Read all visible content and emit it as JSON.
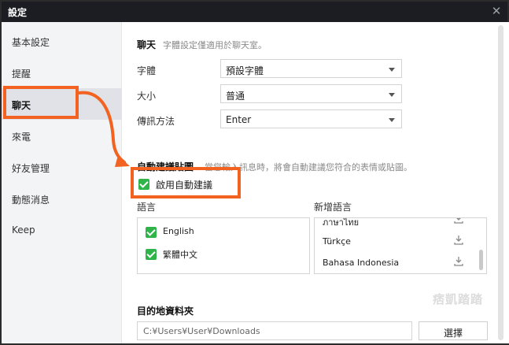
{
  "window": {
    "title": "設定",
    "close_icon": "close-icon"
  },
  "sidebar": {
    "items": [
      {
        "label": "基本設定"
      },
      {
        "label": "提醒"
      },
      {
        "label": "聊天",
        "active": true
      },
      {
        "label": "來電"
      },
      {
        "label": "好友管理"
      },
      {
        "label": "動態消息"
      },
      {
        "label": "Keep"
      }
    ]
  },
  "chat_section": {
    "title": "聊天",
    "description": "字體設定僅適用於聊天室。",
    "font": {
      "label": "字體",
      "value": "預設字體"
    },
    "size": {
      "label": "大小",
      "value": "普通"
    },
    "send_method": {
      "label": "傳訊方法",
      "value": "Enter"
    }
  },
  "auto_suggest": {
    "title": "自動建議貼圖",
    "description": "當您輸入訊息時，將會自動建議您符合的表情或貼圖。",
    "enable_label": "啟用自動建議",
    "enabled": true,
    "languages_header": "語言",
    "languages": [
      {
        "name": "English",
        "checked": true
      },
      {
        "name": "繁體中文",
        "checked": true
      }
    ],
    "add_language_header": "新增語言",
    "available_languages": [
      {
        "name": "ภาษาไทย"
      },
      {
        "name": "Türkçe"
      },
      {
        "name": "Bahasa Indonesia"
      }
    ]
  },
  "watermark": "痞凱踏踏",
  "destination": {
    "title": "目的地資料夾",
    "path": "C:¥Users¥User¥Downloads",
    "browse_label": "選擇"
  },
  "colors": {
    "highlight": "#f26322",
    "checkbox": "#2fb449",
    "titlebar": "#1b1d22"
  }
}
